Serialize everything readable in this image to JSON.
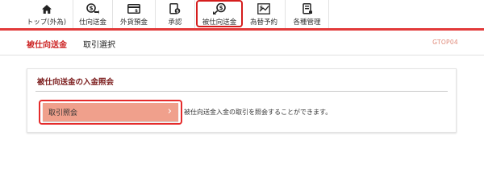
{
  "nav": {
    "items": [
      {
        "label": "トップ(外為)",
        "icon": "home-icon"
      },
      {
        "label": "仕向送金",
        "icon": "outgoing-remittance-icon"
      },
      {
        "label": "外貨預金",
        "icon": "foreign-deposit-icon"
      },
      {
        "label": "承認",
        "icon": "approval-icon"
      },
      {
        "label": "被仕向送金",
        "icon": "incoming-remittance-icon",
        "active": true
      },
      {
        "label": "為替予約",
        "icon": "forex-contract-icon"
      },
      {
        "label": "各種管理",
        "icon": "management-icon"
      }
    ],
    "accent_color": "#e23a3a"
  },
  "breadcrumb": {
    "current": "被仕向送金",
    "next": "取引選択",
    "screen_id": "GTOP04"
  },
  "card": {
    "title": "被仕向送金の入金照会",
    "action": {
      "label": "取引照会",
      "chevron": "›",
      "description": "被仕向送金入金の取引を照会することができます。"
    }
  }
}
